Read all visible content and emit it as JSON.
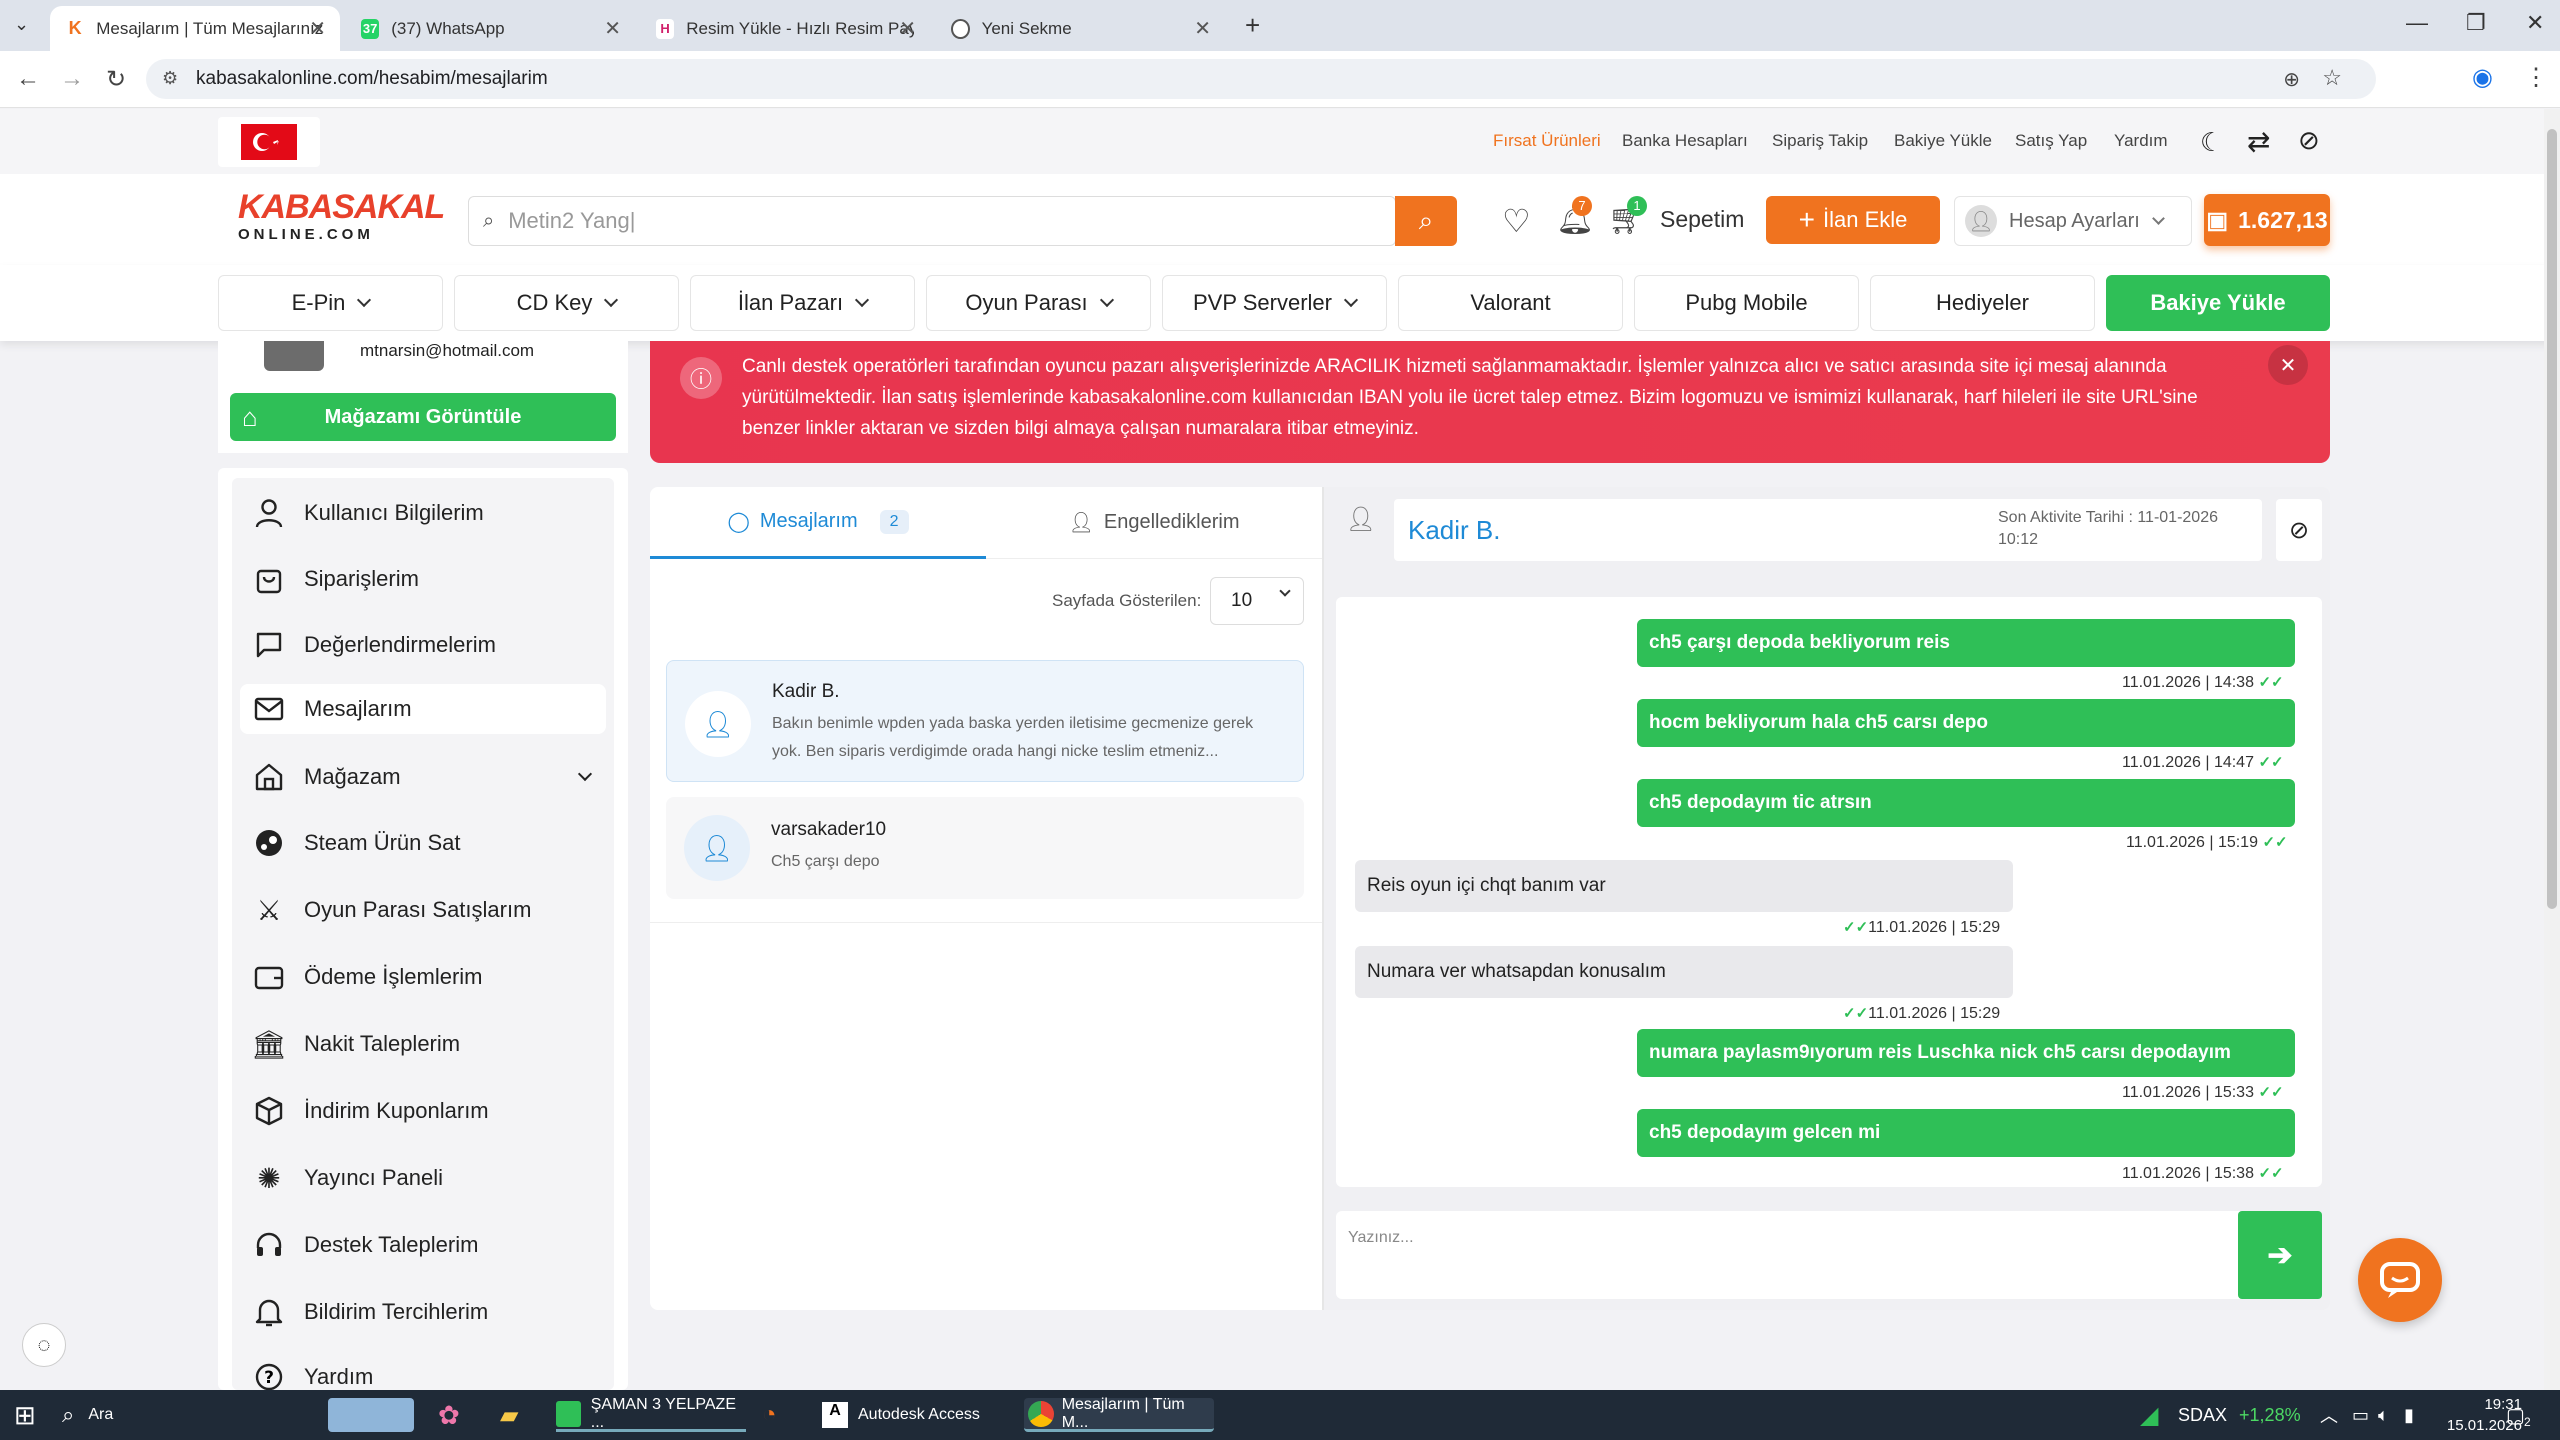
{
  "browser": {
    "tabs": [
      {
        "title": "Mesajlarım | Tüm Mesajlarınız",
        "active": true,
        "favicon": "K"
      },
      {
        "title": "(37) WhatsApp",
        "active": false,
        "favicon": "37"
      },
      {
        "title": "Resim Yükle - Hızlı Resim Payla",
        "active": false,
        "favicon": "H"
      },
      {
        "title": "Yeni Sekme",
        "active": false,
        "favicon": "G"
      }
    ],
    "url": "kabasakalonline.com/hesabim/mesajlarim"
  },
  "topbar": {
    "links": [
      "Fırsat Ürünleri",
      "Banka Hesapları",
      "Sipariş Takip",
      "Bakiye Yükle",
      "Satış Yap",
      "Yardım"
    ]
  },
  "header": {
    "logo_top": "KABASAKAL",
    "logo_bottom": "ONLINE.COM",
    "search_placeholder": "Metin2 Yang|",
    "notif_count": "7",
    "cart_count": "1",
    "cart_label": "Sepetim",
    "add_listing": "İlan Ekle",
    "account": "Hesap Ayarları",
    "balance": "1.627,13"
  },
  "nav": {
    "items": [
      "E-Pin",
      "CD Key",
      "İlan Pazarı",
      "Oyun Parası",
      "PVP Serverler",
      "Valorant",
      "Pubg Mobile",
      "Hediyeler",
      "Bakiye Yükle"
    ]
  },
  "profile": {
    "email": "mtnarsin@hotmail.com",
    "store_button": "Mağazamı Görüntüle"
  },
  "sidebar": {
    "items": [
      "Kullanıcı Bilgilerim",
      "Siparişlerim",
      "Değerlendirmelerim",
      "Mesajlarım",
      "Mağazam",
      "Steam Ürün Sat",
      "Oyun Parası Satışlarım",
      "Ödeme İşlemlerim",
      "Nakit Taleplerim",
      "İndirim Kuponlarım",
      "Yayıncı Paneli",
      "Destek Taleplerim",
      "Bildirim Tercihlerim",
      "Yardım"
    ]
  },
  "alert": {
    "line1": "Canlı destek operatörleri tarafından oyuncu pazarı alışverişlerinizde ARACILIK hizmeti sağlanmamaktadır. İşlemler yalnızca alıcı ve satıcı arasında site içi mesaj alanında",
    "line2": "yürütülmektedir. İlan satış işlemlerinde kabasakalonline.com kullanıcıdan IBAN yolu ile ücret talep etmez. Bizim logomuzu ve ismimizi kullanarak, harf hileleri ile site URL'sine",
    "line3": "benzer linkler aktaran ve sizden bilgi almaya çalışan numaralara itibar etmeyiniz."
  },
  "messages_panel": {
    "tab_messages": "Mesajlarım",
    "tab_messages_count": "2",
    "tab_blocked": "Engellediklerim",
    "per_page_label": "Sayfada Gösterilen:",
    "per_page_value": "10",
    "conversations": [
      {
        "name": "Kadir B.",
        "preview1": "Bakın benimle wpden yada baska yerden iletisime gecmenize gerek",
        "preview2": "yok. Ben siparis verdigimde orada hangi nicke teslim etmeniz..."
      },
      {
        "name": "varsakader10",
        "preview1": "Ch5 çarşı depo",
        "preview2": ""
      }
    ]
  },
  "chat": {
    "name": "Kadir B.",
    "activity_label": "Son Aktivite Tarihi : 11-01-2026",
    "activity_time": "10:12",
    "input_placeholder": "Yazınız...",
    "messages": [
      {
        "from": "me",
        "text": "ch5 çarşı depoda bekliyorum reis",
        "time": "11.01.2026 | 14:38"
      },
      {
        "from": "me",
        "text": "hocm bekliyorum hala ch5 carsı depo",
        "time": "11.01.2026 | 14:47"
      },
      {
        "from": "me",
        "text": "ch5 depodayım tic atrsın",
        "time": "11.01.2026 | 15:19"
      },
      {
        "from": "them",
        "text": "Reis oyun içi chqt banım var",
        "time": "11.01.2026 | 15:29"
      },
      {
        "from": "them",
        "text": "Numara ver whatsapdan konusalım",
        "time": "11.01.2026 | 15:29"
      },
      {
        "from": "me",
        "text": "numara paylasm9ıyorum reis Luschka nick ch5 carsı depodayım",
        "time": "11.01.2026 | 15:33"
      },
      {
        "from": "me",
        "text": "ch5 depodayım gelcen mi",
        "time": "11.01.2026 | 15:38"
      }
    ]
  },
  "taskbar": {
    "search": "Ara",
    "apps": [
      "ŞAMAN 3 YELPAZE ...",
      "Autodesk Access",
      "Mesajlarım | Tüm M..."
    ],
    "ticker_name": "SDAX",
    "ticker_value": "+1,28%",
    "clock_time": "19:31",
    "clock_date": "15.01.2026",
    "notif_count": "2"
  },
  "colors": {
    "brand_orange": "#f0731f",
    "green": "#2fbf57",
    "alert_red": "#e8354f",
    "link_blue": "#1e8ad6"
  }
}
